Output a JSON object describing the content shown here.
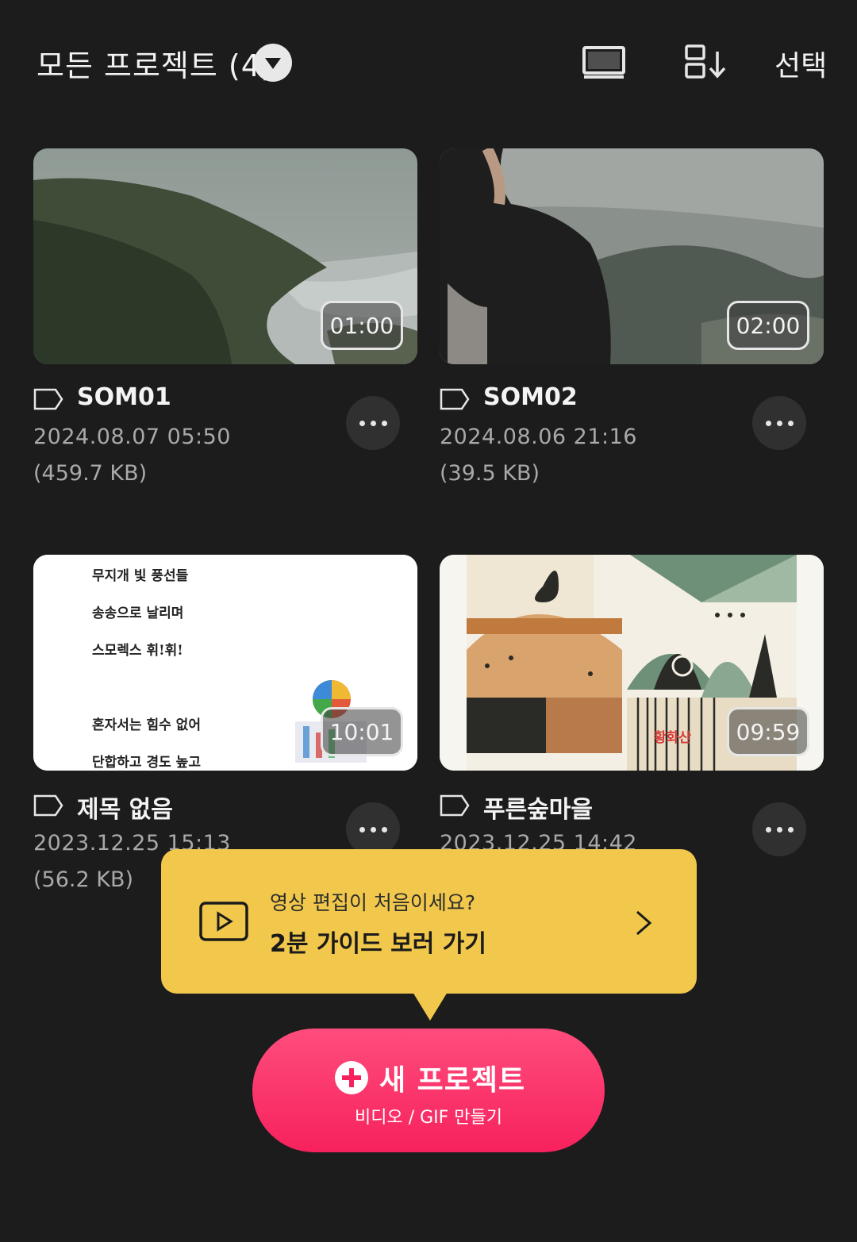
{
  "header": {
    "title": "모든 프로젝트 (4)",
    "select_label": "선택",
    "icons": [
      "chevron-down-icon",
      "view-mode-icon",
      "sort-icon"
    ]
  },
  "projects": [
    {
      "name": "SOM01",
      "date": "2024.08.07  05:50",
      "size": "(459.7 KB)",
      "duration": "01:00"
    },
    {
      "name": "SOM02",
      "date": "2024.08.06  21:16",
      "size": "(39.5 KB)",
      "duration": "02:00"
    },
    {
      "name": "제목 없음",
      "date": "2023.12.25  15:13",
      "size": "(56.2 KB)",
      "duration": "10:01",
      "thumb_lines": [
        "무지개 빛 풍선들",
        "송송으로 날리며",
        "스모렉스 휘!휘!",
        "혼자서는 힘수 없어",
        "단합하고 경도 높고"
      ]
    },
    {
      "name": "푸른숲마을",
      "date": "2023.12.25  14:42",
      "size": "",
      "duration": "09:59",
      "thumb_caption": "황화산"
    }
  ],
  "tooltip": {
    "question": "영상 편집이 처음이세요?",
    "link": "2분 가이드 보러 가기"
  },
  "new_project": {
    "label": "새 프로젝트",
    "sub": "비디오 / GIF 만들기"
  },
  "colors": {
    "background": "#1c1c1c",
    "tooltip": "#f1c84c",
    "accent": "#f7215d"
  }
}
